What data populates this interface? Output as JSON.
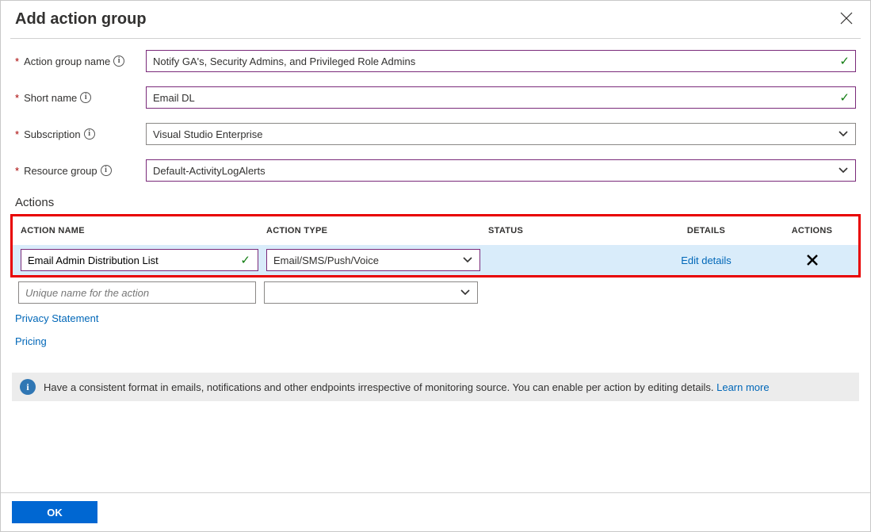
{
  "header": {
    "title": "Add action group"
  },
  "form": {
    "action_group_name": {
      "label": "Action group name",
      "value": "Notify GA's, Security Admins, and Privileged Role Admins"
    },
    "short_name": {
      "label": "Short name",
      "value": "Email DL"
    },
    "subscription": {
      "label": "Subscription",
      "value": "Visual Studio Enterprise"
    },
    "resource_group": {
      "label": "Resource group",
      "value": "Default-ActivityLogAlerts"
    }
  },
  "actions_section": {
    "title": "Actions",
    "columns": {
      "name": "ACTION NAME",
      "type": "ACTION TYPE",
      "status": "STATUS",
      "details": "DETAILS",
      "actions": "ACTIONS"
    },
    "row1": {
      "name": "Email Admin Distribution List",
      "type": "Email/SMS/Push/Voice",
      "status": "",
      "details_link": "Edit details"
    },
    "blank_placeholder": "Unique name for the action"
  },
  "links": {
    "privacy": "Privacy Statement",
    "pricing": "Pricing"
  },
  "info_bar": {
    "text": "Have a consistent format in emails, notifications and other endpoints irrespective of monitoring source. You can enable per action by editing details. ",
    "learn_more": "Learn more"
  },
  "footer": {
    "ok": "OK"
  }
}
